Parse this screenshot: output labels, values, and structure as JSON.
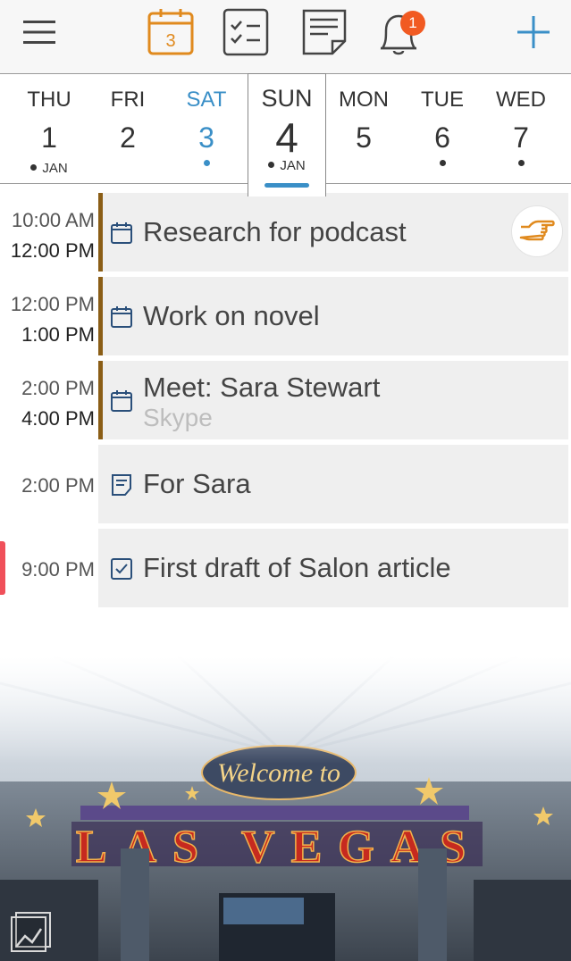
{
  "toolbar": {
    "calendar_date": "3",
    "notification_count": "1",
    "icons": [
      "menu-icon",
      "calendar-icon",
      "tasks-icon",
      "notes-icon",
      "bell-icon",
      "add-icon"
    ]
  },
  "week": {
    "days": [
      {
        "dow": "THU",
        "num": "1",
        "month": "JAN"
      },
      {
        "dow": "FRI",
        "num": "2"
      },
      {
        "dow": "SAT",
        "num": "3"
      },
      {
        "dow": "SUN",
        "num": "4",
        "month": "JAN"
      },
      {
        "dow": "MON",
        "num": "5"
      },
      {
        "dow": "TUE",
        "num": "6"
      },
      {
        "dow": "WED",
        "num": "7"
      }
    ]
  },
  "events": [
    {
      "start": "10:00 AM",
      "end": "12:00 PM",
      "title": "Research for podcast",
      "type": "event"
    },
    {
      "start": "12:00 PM",
      "end": "1:00 PM",
      "title": "Work on novel",
      "type": "event"
    },
    {
      "start": "2:00 PM",
      "end": "4:00 PM",
      "title": "Meet: Sara Stewart",
      "subtitle": "Skype",
      "type": "event"
    },
    {
      "time": "2:00 PM",
      "title": "For Sara",
      "type": "note"
    },
    {
      "time": "9:00 PM",
      "title": "First draft of Salon article",
      "type": "task"
    }
  ],
  "colors": {
    "accent_orange": "#e08a1e",
    "accent_blue": "#3a8fc7",
    "badge": "#f15a22",
    "event_bar": "#8b5e16",
    "now_marker": "#f0505a"
  }
}
